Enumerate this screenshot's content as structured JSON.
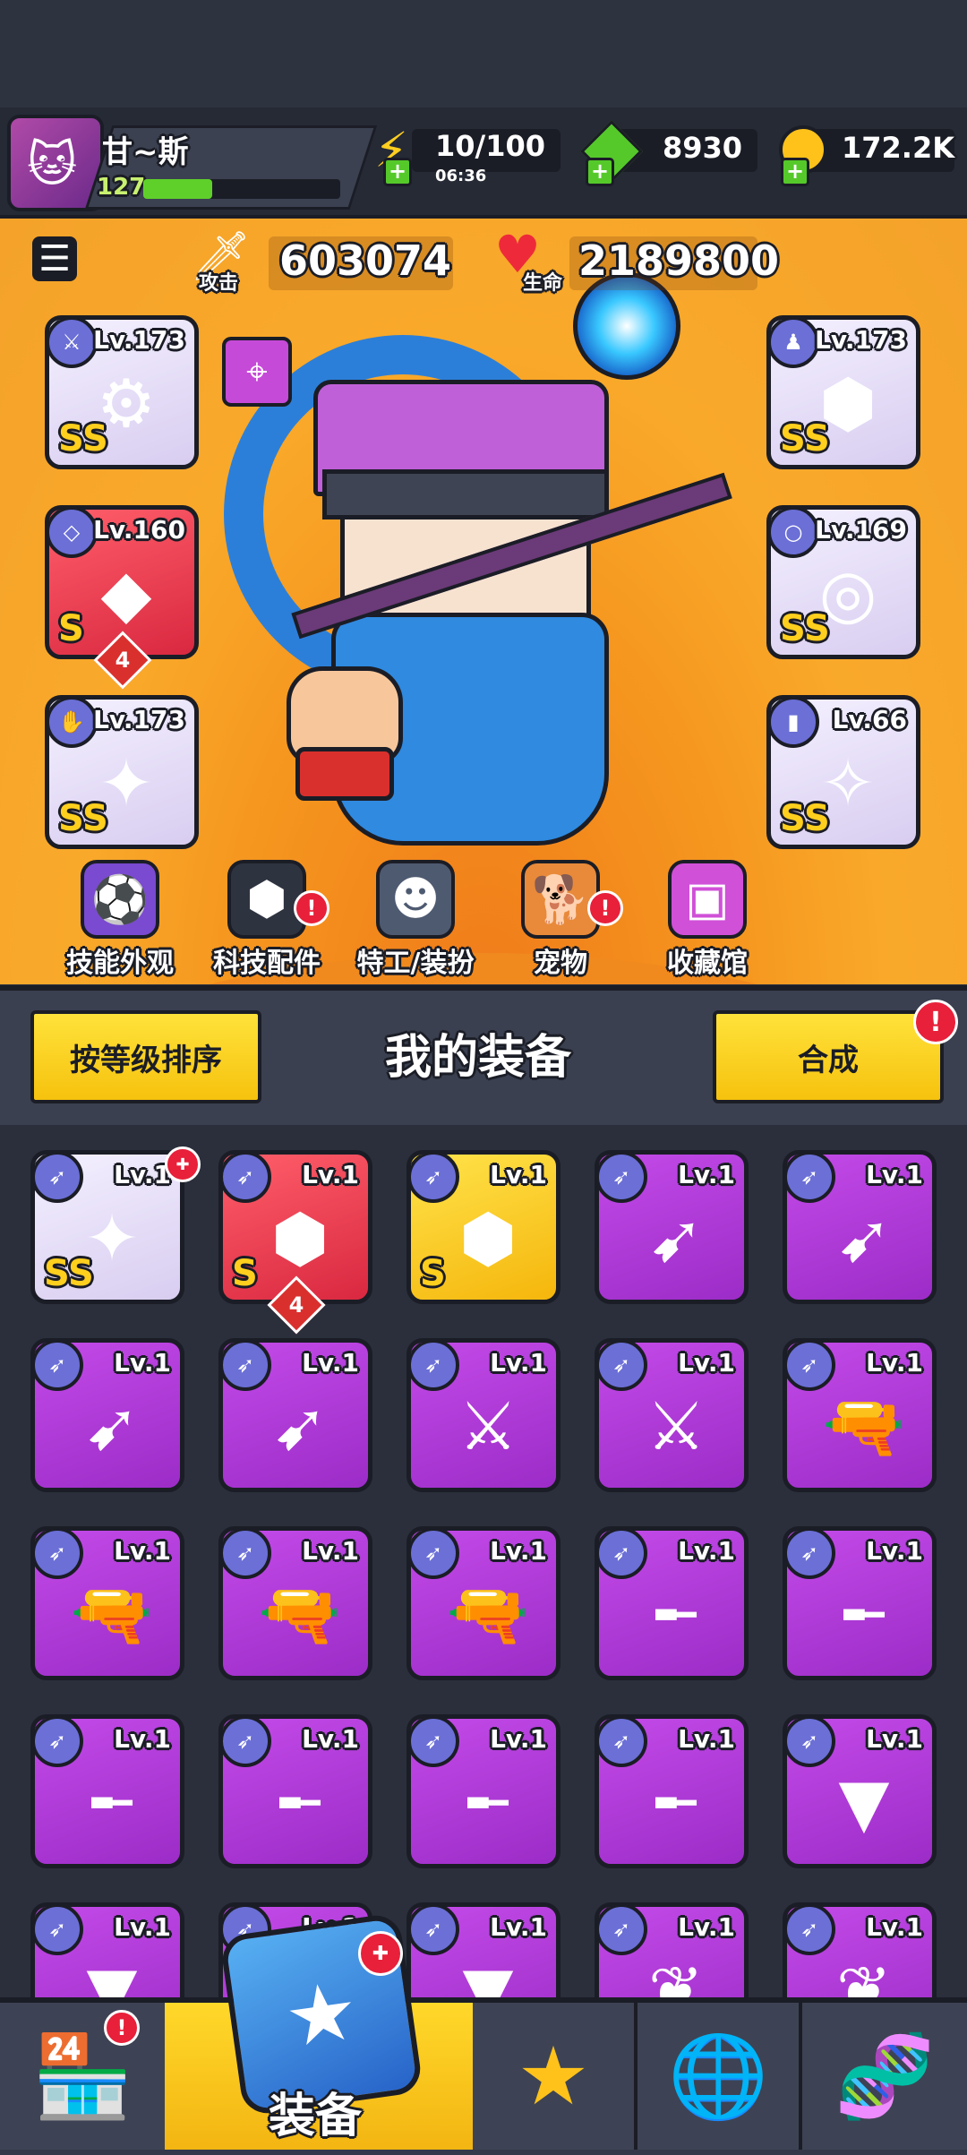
{
  "player": {
    "name": "甘~斯",
    "level": "127",
    "xp_fraction": 0.35
  },
  "resources": {
    "energy": {
      "value": "10/100",
      "timer": "06:36",
      "icon": "lightning-icon"
    },
    "gems": {
      "value": "8930",
      "icon": "green-gem-icon"
    },
    "coins": {
      "value": "172.2K",
      "icon": "gold-coin-icon"
    }
  },
  "stats": {
    "attack": {
      "label": "攻击",
      "value": "603074",
      "icon": "sword-icon"
    },
    "hp": {
      "label": "生命",
      "value": "2189800",
      "icon": "heart-icon"
    }
  },
  "equipped": {
    "left": [
      {
        "level": "Lv.173",
        "rarity": "SS",
        "frame": "white",
        "glyph": "⚙",
        "cat": "weapon"
      },
      {
        "level": "Lv.160",
        "rarity": "S",
        "frame": "red",
        "glyph": "◆",
        "cat": "necklace",
        "stars": "4"
      },
      {
        "level": "Lv.173",
        "rarity": "SS",
        "frame": "white",
        "glyph": "✦",
        "cat": "glove"
      }
    ],
    "right": [
      {
        "level": "Lv.173",
        "rarity": "SS",
        "frame": "white",
        "glyph": "⬢",
        "cat": "armor"
      },
      {
        "level": "Lv.169",
        "rarity": "SS",
        "frame": "white",
        "glyph": "◎",
        "cat": "belt"
      },
      {
        "level": "Lv.66",
        "rarity": "SS",
        "frame": "white",
        "glyph": "✧",
        "cat": "boots"
      }
    ]
  },
  "nav_row": [
    {
      "label": "技能外观",
      "icon": "soccer-hat-icon",
      "badge": false
    },
    {
      "label": "科技配件",
      "icon": "tech-hex-icon",
      "badge": true
    },
    {
      "label": "特工/装扮",
      "icon": "agent-icon",
      "badge": false
    },
    {
      "label": "宠物",
      "icon": "pet-dog-icon",
      "badge": true
    },
    {
      "label": "收藏馆",
      "icon": "chest-icon",
      "badge": false
    }
  ],
  "equipment_header": {
    "sort_label": "按等级排序",
    "title": "我的装备",
    "merge_label": "合成"
  },
  "inventory": [
    {
      "level": "Lv.1",
      "frame": "white",
      "rarity": "SS",
      "glyph": "✦",
      "new": true
    },
    {
      "level": "Lv.1",
      "frame": "red",
      "rarity": "S",
      "glyph": "⬢",
      "stars": "4"
    },
    {
      "level": "Lv.1",
      "frame": "yellow",
      "rarity": "S",
      "glyph": "⬢"
    },
    {
      "level": "Lv.1",
      "frame": "purple",
      "glyph": "➹"
    },
    {
      "level": "Lv.1",
      "frame": "purple",
      "glyph": "➹"
    },
    {
      "level": "Lv.1",
      "frame": "purple",
      "glyph": "➹"
    },
    {
      "level": "Lv.1",
      "frame": "purple",
      "glyph": "➹"
    },
    {
      "level": "Lv.1",
      "frame": "purple",
      "glyph": "⚔"
    },
    {
      "level": "Lv.1",
      "frame": "purple",
      "glyph": "⚔"
    },
    {
      "level": "Lv.1",
      "frame": "purple",
      "glyph": "🔫"
    },
    {
      "level": "Lv.1",
      "frame": "purple",
      "glyph": "🔫"
    },
    {
      "level": "Lv.1",
      "frame": "purple",
      "glyph": "🔫"
    },
    {
      "level": "Lv.1",
      "frame": "purple",
      "glyph": "🔫"
    },
    {
      "level": "Lv.1",
      "frame": "purple",
      "glyph": "╾"
    },
    {
      "level": "Lv.1",
      "frame": "purple",
      "glyph": "╾"
    },
    {
      "level": "Lv.1",
      "frame": "purple",
      "glyph": "╾"
    },
    {
      "level": "Lv.1",
      "frame": "purple",
      "glyph": "╾"
    },
    {
      "level": "Lv.1",
      "frame": "purple",
      "glyph": "╾"
    },
    {
      "level": "Lv.1",
      "frame": "purple",
      "glyph": "╾"
    },
    {
      "level": "Lv.1",
      "frame": "purple",
      "glyph": "▼"
    },
    {
      "level": "Lv.1",
      "frame": "purple",
      "glyph": "▼"
    },
    {
      "level": "Lv.1",
      "frame": "purple",
      "glyph": "▼"
    },
    {
      "level": "Lv.1",
      "frame": "purple",
      "glyph": "▼"
    },
    {
      "level": "Lv.1",
      "frame": "purple",
      "glyph": "❦"
    },
    {
      "level": "Lv.1",
      "frame": "purple",
      "glyph": "❦"
    }
  ],
  "bottom_tabs": [
    {
      "name": "shop",
      "icon": "shop-icon",
      "badge": true
    },
    {
      "name": "equipment",
      "label": "装备",
      "icon": "equipment-icon",
      "active": true
    },
    {
      "name": "battle",
      "icon": "crossed-swords-star-icon"
    },
    {
      "name": "events",
      "icon": "star-ball-icon"
    },
    {
      "name": "dna",
      "icon": "dna-capsule-icon"
    }
  ]
}
